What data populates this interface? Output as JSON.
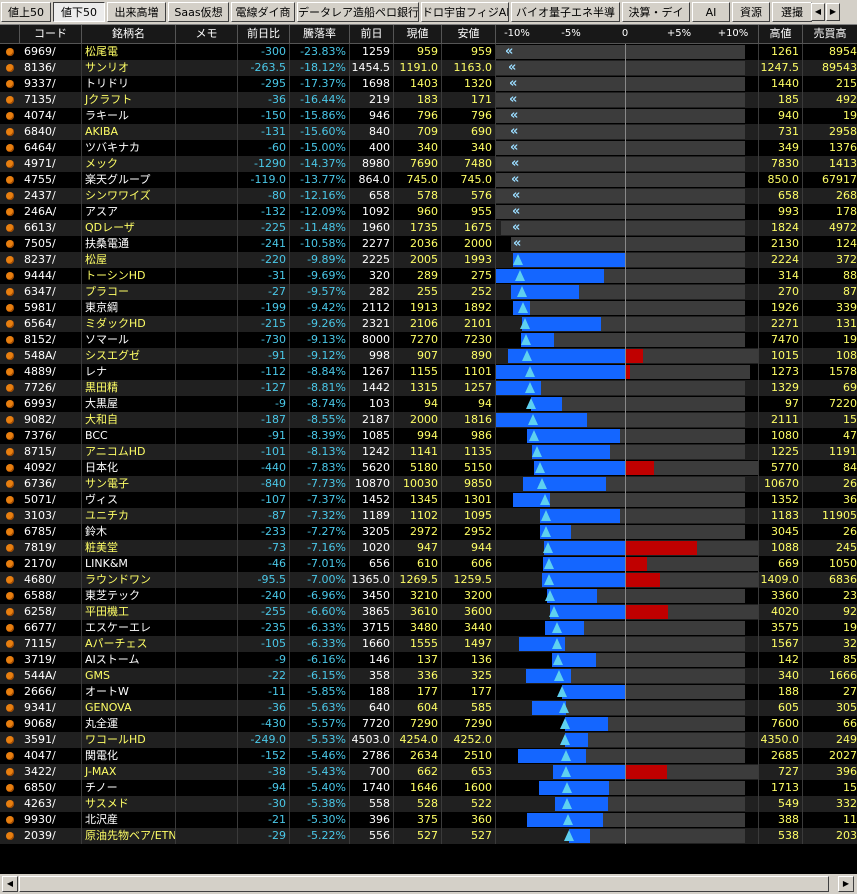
{
  "tabs": [
    {
      "label": "値上50",
      "active": false
    },
    {
      "label": "値下50",
      "active": true
    },
    {
      "label": "出来高増",
      "active": false
    },
    {
      "label": "Saas仮想",
      "active": false
    },
    {
      "label": "電線ダイ商",
      "active": false
    },
    {
      "label": "データレア造船ペロ銀行",
      "active": false
    },
    {
      "label": "ドロ宇宙フィジAI",
      "active": false
    },
    {
      "label": "バイオ量子エネ半導",
      "active": false
    },
    {
      "label": "決算・デイ",
      "active": false
    },
    {
      "label": "AI",
      "active": false
    },
    {
      "label": "資源",
      "active": false
    },
    {
      "label": "選撮",
      "active": false
    }
  ],
  "header": {
    "code": "コード",
    "name": "銘柄名",
    "memo": "メモ",
    "change": "前日比",
    "drop_pct": "騰落率",
    "prev": "前日",
    "current": "現値",
    "low": "安値",
    "high": "高値",
    "vol": "売買高"
  },
  "scale_labels": [
    "-10%",
    "-5%",
    "0",
    "+5%",
    "+10%"
  ],
  "colors": {
    "up_bar": "#c00000",
    "down_bar": "#1466ff",
    "marker": "#5ed0f0",
    "yellow": "#ffff66",
    "cyan": "#4ac8e8"
  },
  "rows": [
    {
      "code": "6969/",
      "name": "松尾電",
      "yel": true,
      "chg": "-300",
      "pct": "-23.83%",
      "prev": "1259",
      "cur": "959",
      "low": "959",
      "high": "1261",
      "vol": "8954",
      "bar": [
        -10,
        -10,
        -23.83,
        -23.83,
        0.2
      ]
    },
    {
      "code": "8136/",
      "name": "サンリオ",
      "yel": true,
      "chg": "-263.5",
      "pct": "-18.12%",
      "prev": "1454.5",
      "cur": "1191.0",
      "low": "1163.0",
      "high": "1247.5",
      "vol": "89543",
      "bar": [
        -10,
        -10,
        -18.12,
        -18.12,
        -14.2
      ]
    },
    {
      "code": "9337/",
      "name": "トリドリ",
      "yel": false,
      "chg": "-295",
      "pct": "-17.37%",
      "prev": "1698",
      "cur": "1403",
      "low": "1320",
      "high": "1440",
      "vol": "215",
      "bar": [
        -10,
        -10,
        -17.37,
        -17.37,
        -15.2
      ]
    },
    {
      "code": "7135/",
      "name": "Jクラフト",
      "yel": true,
      "chg": "-36",
      "pct": "-16.44%",
      "prev": "219",
      "cur": "183",
      "low": "171",
      "high": "185",
      "vol": "492",
      "bar": [
        -10,
        -10,
        -16.44,
        -16.44,
        -15.5
      ]
    },
    {
      "code": "4074/",
      "name": "ラキール",
      "yel": false,
      "chg": "-150",
      "pct": "-15.86%",
      "prev": "946",
      "cur": "796",
      "low": "796",
      "high": "940",
      "vol": "19",
      "bar": [
        -10,
        -10,
        -15.86,
        -15.86,
        -0.6
      ]
    },
    {
      "code": "6840/",
      "name": "AKIBA",
      "yel": true,
      "chg": "-131",
      "pct": "-15.60%",
      "prev": "840",
      "cur": "709",
      "low": "690",
      "high": "731",
      "vol": "2958",
      "bar": [
        -10,
        -10,
        -15.6,
        -15.6,
        -13.0
      ]
    },
    {
      "code": "6464/",
      "name": "ツバキナカ",
      "yel": false,
      "chg": "-60",
      "pct": "-15.00%",
      "prev": "400",
      "cur": "340",
      "low": "340",
      "high": "349",
      "vol": "1376",
      "bar": [
        -10,
        -10,
        -15.0,
        -15.0,
        -12.8
      ]
    },
    {
      "code": "4971/",
      "name": "メック",
      "yel": true,
      "chg": "-1290",
      "pct": "-14.37%",
      "prev": "8980",
      "cur": "7690",
      "low": "7480",
      "high": "7830",
      "vol": "1413",
      "bar": [
        -10,
        -10,
        -14.37,
        -14.37,
        -12.8
      ]
    },
    {
      "code": "4755/",
      "name": "楽天グループ",
      "yel": false,
      "chg": "-119.0",
      "pct": "-13.77%",
      "prev": "864.0",
      "cur": "745.0",
      "low": "745.0",
      "high": "850.0",
      "vol": "67917",
      "bar": [
        -10,
        -10,
        -13.77,
        -13.77,
        -1.6
      ]
    },
    {
      "code": "2437/",
      "name": "シンワワイズ",
      "yel": true,
      "chg": "-80",
      "pct": "-12.16%",
      "prev": "658",
      "cur": "578",
      "low": "576",
      "high": "658",
      "vol": "268",
      "bar": [
        -10,
        -10,
        -12.16,
        -12.16,
        0
      ]
    },
    {
      "code": "246A/",
      "name": "アスア",
      "yel": false,
      "chg": "-132",
      "pct": "-12.09%",
      "prev": "1092",
      "cur": "960",
      "low": "955",
      "high": "993",
      "vol": "178",
      "bar": [
        -10,
        -10,
        -12.09,
        -12.09,
        -9.1
      ]
    },
    {
      "code": "6613/",
      "name": "QDレーザ",
      "yel": true,
      "chg": "-225",
      "pct": "-11.48%",
      "prev": "1960",
      "cur": "1735",
      "low": "1675",
      "high": "1824",
      "vol": "4972",
      "bar": [
        -10,
        -10,
        -11.48,
        -11.48,
        -6.9
      ]
    },
    {
      "code": "7505/",
      "name": "扶桑電通",
      "yel": false,
      "chg": "-241",
      "pct": "-10.58%",
      "prev": "2277",
      "cur": "2036",
      "low": "2000",
      "high": "2130",
      "vol": "124",
      "bar": [
        -10,
        -10,
        -10.58,
        -10.58,
        -6.5
      ]
    },
    {
      "code": "8237/",
      "name": "松屋",
      "yel": true,
      "chg": "-220",
      "pct": "-9.89%",
      "prev": "2225",
      "cur": "2005",
      "low": "1993",
      "high": "2224",
      "vol": "372",
      "bar": [
        -10,
        -10.4,
        -9.89,
        0,
        0
      ]
    },
    {
      "code": "9444/",
      "name": "トーシンHD",
      "yel": true,
      "chg": "-31",
      "pct": "-9.69%",
      "prev": "320",
      "cur": "289",
      "low": "275",
      "high": "314",
      "vol": "88",
      "bar": [
        -10,
        -14.0,
        -9.69,
        -1.9,
        -1.9
      ]
    },
    {
      "code": "6347/",
      "name": "プラコー",
      "yel": true,
      "chg": "-27",
      "pct": "-9.57%",
      "prev": "282",
      "cur": "255",
      "low": "252",
      "high": "270",
      "vol": "87",
      "bar": [
        -10,
        -10.6,
        -9.57,
        -4.3,
        -4.3
      ]
    },
    {
      "code": "5981/",
      "name": "東京綱",
      "yel": false,
      "chg": "-199",
      "pct": "-9.42%",
      "prev": "2112",
      "cur": "1913",
      "low": "1892",
      "high": "1926",
      "vol": "339",
      "bar": [
        -10,
        -10.4,
        -9.42,
        -8.8,
        -8.8
      ]
    },
    {
      "code": "6564/",
      "name": "ミダックHD",
      "yel": true,
      "chg": "-215",
      "pct": "-9.26%",
      "prev": "2321",
      "cur": "2106",
      "low": "2101",
      "high": "2271",
      "vol": "131",
      "bar": [
        -10,
        -9.5,
        -9.26,
        -2.2,
        -2.2
      ]
    },
    {
      "code": "8152/",
      "name": "ソマール",
      "yel": false,
      "chg": "-730",
      "pct": "-9.13%",
      "prev": "8000",
      "cur": "7270",
      "low": "7230",
      "high": "7470",
      "vol": "19",
      "bar": [
        -10,
        -9.6,
        -9.13,
        -6.6,
        -6.6
      ]
    },
    {
      "code": "548A/",
      "name": "シスエグゼ",
      "yel": true,
      "chg": "-91",
      "pct": "-9.12%",
      "prev": "998",
      "cur": "907",
      "low": "890",
      "high": "1015",
      "vol": "108",
      "bar": [
        -10,
        -10.8,
        -9.12,
        1.7,
        1.7
      ]
    },
    {
      "code": "4889/",
      "name": "レナ",
      "yel": false,
      "chg": "-112",
      "pct": "-8.84%",
      "prev": "1267",
      "cur": "1155",
      "low": "1101",
      "high": "1273",
      "vol": "1578",
      "bar": [
        -10,
        -13.1,
        -8.84,
        0.5,
        0.5
      ]
    },
    {
      "code": "7726/",
      "name": "黒田精",
      "yel": true,
      "chg": "-127",
      "pct": "-8.81%",
      "prev": "1442",
      "cur": "1315",
      "low": "1257",
      "high": "1329",
      "vol": "69",
      "bar": [
        -10,
        -12.8,
        -8.81,
        -7.8,
        -7.8
      ]
    },
    {
      "code": "6993/",
      "name": "大黒屋",
      "yel": false,
      "chg": "-9",
      "pct": "-8.74%",
      "prev": "103",
      "cur": "94",
      "low": "94",
      "high": "97",
      "vol": "7220",
      "bar": [
        -10,
        -8.74,
        -8.74,
        -5.8,
        -5.8
      ]
    },
    {
      "code": "9082/",
      "name": "大和自",
      "yel": true,
      "chg": "-187",
      "pct": "-8.55%",
      "prev": "2187",
      "cur": "2000",
      "low": "1816",
      "high": "2111",
      "vol": "15",
      "bar": [
        -10,
        -17.0,
        -8.55,
        -3.5,
        -3.5
      ]
    },
    {
      "code": "7376/",
      "name": "BCC",
      "yel": false,
      "chg": "-91",
      "pct": "-8.39%",
      "prev": "1085",
      "cur": "994",
      "low": "986",
      "high": "1080",
      "vol": "47",
      "bar": [
        -10,
        -9.1,
        -8.39,
        -0.5,
        -0.5
      ]
    },
    {
      "code": "8715/",
      "name": "アニコムHD",
      "yel": true,
      "chg": "-101",
      "pct": "-8.13%",
      "prev": "1242",
      "cur": "1141",
      "low": "1135",
      "high": "1225",
      "vol": "1191",
      "bar": [
        -10,
        -8.6,
        -8.13,
        -1.4,
        -1.4
      ]
    },
    {
      "code": "4092/",
      "name": "日本化",
      "yel": false,
      "chg": "-440",
      "pct": "-7.83%",
      "prev": "5620",
      "cur": "5180",
      "low": "5150",
      "high": "5770",
      "vol": "84",
      "bar": [
        -10,
        -8.4,
        -7.83,
        2.7,
        2.7
      ]
    },
    {
      "code": "6736/",
      "name": "サン電子",
      "yel": true,
      "chg": "-840",
      "pct": "-7.73%",
      "prev": "10870",
      "cur": "10030",
      "low": "9850",
      "high": "10670",
      "vol": "26",
      "bar": [
        -10,
        -9.4,
        -7.73,
        -1.8,
        -1.8
      ]
    },
    {
      "code": "5071/",
      "name": "ヴィス",
      "yel": false,
      "chg": "-107",
      "pct": "-7.37%",
      "prev": "1452",
      "cur": "1345",
      "low": "1301",
      "high": "1352",
      "vol": "36",
      "bar": [
        -10,
        -10.4,
        -7.37,
        -6.9,
        -6.9
      ]
    },
    {
      "code": "3103/",
      "name": "ユニチカ",
      "yel": true,
      "chg": "-87",
      "pct": "-7.32%",
      "prev": "1189",
      "cur": "1102",
      "low": "1095",
      "high": "1183",
      "vol": "11905",
      "bar": [
        -10,
        -7.9,
        -7.32,
        -0.5,
        -0.5
      ]
    },
    {
      "code": "6785/",
      "name": "鈴木",
      "yel": false,
      "chg": "-233",
      "pct": "-7.27%",
      "prev": "3205",
      "cur": "2972",
      "low": "2952",
      "high": "3045",
      "vol": "26",
      "bar": [
        -10,
        -7.9,
        -7.27,
        -5.0,
        -5.0
      ]
    },
    {
      "code": "7819/",
      "name": "粧美堂",
      "yel": true,
      "chg": "-73",
      "pct": "-7.16%",
      "prev": "1020",
      "cur": "947",
      "low": "944",
      "high": "1088",
      "vol": "245",
      "bar": [
        -10,
        -7.5,
        -7.16,
        6.7,
        6.7
      ]
    },
    {
      "code": "2170/",
      "name": "LINK&M",
      "yel": false,
      "chg": "-46",
      "pct": "-7.01%",
      "prev": "656",
      "cur": "610",
      "low": "606",
      "high": "669",
      "vol": "1050",
      "bar": [
        -10,
        -7.6,
        -7.01,
        2.0,
        2.0
      ]
    },
    {
      "code": "4680/",
      "name": "ラウンドワン",
      "yel": true,
      "chg": "-95.5",
      "pct": "-7.00%",
      "prev": "1365.0",
      "cur": "1269.5",
      "low": "1259.5",
      "high": "1409.0",
      "vol": "6836",
      "bar": [
        -10,
        -7.7,
        -7.0,
        3.2,
        3.2
      ]
    },
    {
      "code": "6588/",
      "name": "東芝テック",
      "yel": false,
      "chg": "-240",
      "pct": "-6.96%",
      "prev": "3450",
      "cur": "3210",
      "low": "3200",
      "high": "3360",
      "vol": "23",
      "bar": [
        -10,
        -7.2,
        -6.96,
        -2.6,
        -2.6
      ]
    },
    {
      "code": "6258/",
      "name": "平田機工",
      "yel": true,
      "chg": "-255",
      "pct": "-6.60%",
      "prev": "3865",
      "cur": "3610",
      "low": "3600",
      "high": "4020",
      "vol": "92",
      "bar": [
        -10,
        -6.9,
        -6.6,
        4.0,
        4.0
      ]
    },
    {
      "code": "6677/",
      "name": "エスケーエレ",
      "yel": false,
      "chg": "-235",
      "pct": "-6.33%",
      "prev": "3715",
      "cur": "3480",
      "low": "3440",
      "high": "3575",
      "vol": "19",
      "bar": [
        -10,
        -7.4,
        -6.33,
        -3.8,
        -3.8
      ]
    },
    {
      "code": "7115/",
      "name": "Aパーチェス",
      "yel": true,
      "chg": "-105",
      "pct": "-6.33%",
      "prev": "1660",
      "cur": "1555",
      "low": "1497",
      "high": "1567",
      "vol": "32",
      "bar": [
        -10,
        -9.8,
        -6.33,
        -5.6,
        -5.6
      ]
    },
    {
      "code": "3719/",
      "name": "AIストーム",
      "yel": false,
      "chg": "-9",
      "pct": "-6.16%",
      "prev": "146",
      "cur": "137",
      "low": "136",
      "high": "142",
      "vol": "85",
      "bar": [
        -10,
        -6.8,
        -6.16,
        -2.7,
        -2.7
      ]
    },
    {
      "code": "544A/",
      "name": "GMS",
      "yel": true,
      "chg": "-22",
      "pct": "-6.15%",
      "prev": "358",
      "cur": "336",
      "low": "325",
      "high": "340",
      "vol": "1666",
      "bar": [
        -10,
        -9.2,
        -6.15,
        -5.0,
        -5.0
      ]
    },
    {
      "code": "2666/",
      "name": "オートW",
      "yel": false,
      "chg": "-11",
      "pct": "-5.85%",
      "prev": "188",
      "cur": "177",
      "low": "177",
      "high": "188",
      "vol": "27",
      "bar": [
        -10,
        -5.85,
        -5.85,
        0,
        0
      ]
    },
    {
      "code": "9341/",
      "name": "GENOVA",
      "yel": true,
      "chg": "-36",
      "pct": "-5.63%",
      "prev": "640",
      "cur": "604",
      "low": "585",
      "high": "605",
      "vol": "305",
      "bar": [
        -10,
        -8.6,
        -5.63,
        -5.5,
        -5.5
      ]
    },
    {
      "code": "9068/",
      "name": "丸全運",
      "yel": false,
      "chg": "-430",
      "pct": "-5.57%",
      "prev": "7720",
      "cur": "7290",
      "low": "7290",
      "high": "7600",
      "vol": "66",
      "bar": [
        -10,
        -5.57,
        -5.57,
        -1.6,
        -1.6
      ]
    },
    {
      "code": "3591/",
      "name": "ワコールHD",
      "yel": true,
      "chg": "-249.0",
      "pct": "-5.53%",
      "prev": "4503.0",
      "cur": "4254.0",
      "low": "4252.0",
      "high": "4350.0",
      "vol": "249",
      "bar": [
        -10,
        -5.6,
        -5.53,
        -3.4,
        -3.4
      ]
    },
    {
      "code": "4047/",
      "name": "関電化",
      "yel": false,
      "chg": "-152",
      "pct": "-5.46%",
      "prev": "2786",
      "cur": "2634",
      "low": "2510",
      "high": "2685",
      "vol": "2027",
      "bar": [
        -10,
        -9.9,
        -5.46,
        -3.6,
        -3.6
      ]
    },
    {
      "code": "3422/",
      "name": "J-MAX",
      "yel": true,
      "chg": "-38",
      "pct": "-5.43%",
      "prev": "700",
      "cur": "662",
      "low": "653",
      "high": "727",
      "vol": "396",
      "bar": [
        -10,
        -6.7,
        -5.43,
        3.9,
        3.9
      ]
    },
    {
      "code": "6850/",
      "name": "チノー",
      "yel": false,
      "chg": "-94",
      "pct": "-5.40%",
      "prev": "1740",
      "cur": "1646",
      "low": "1600",
      "high": "1713",
      "vol": "15",
      "bar": [
        -10,
        -8.0,
        -5.4,
        -1.5,
        -1.5
      ]
    },
    {
      "code": "4263/",
      "name": "サスメド",
      "yel": true,
      "chg": "-30",
      "pct": "-5.38%",
      "prev": "558",
      "cur": "528",
      "low": "522",
      "high": "549",
      "vol": "332",
      "bar": [
        -10,
        -6.5,
        -5.38,
        -1.6,
        -1.6
      ]
    },
    {
      "code": "9930/",
      "name": "北沢産",
      "yel": false,
      "chg": "-21",
      "pct": "-5.30%",
      "prev": "396",
      "cur": "375",
      "low": "360",
      "high": "388",
      "vol": "11",
      "bar": [
        -10,
        -9.1,
        -5.3,
        -2.0,
        -2.0
      ]
    },
    {
      "code": "2039/",
      "name": "原油先物ベア/ETN",
      "yel": true,
      "chg": "-29",
      "pct": "-5.22%",
      "prev": "556",
      "cur": "527",
      "low": "527",
      "high": "538",
      "vol": "203",
      "bar": [
        -10,
        -5.22,
        -5.22,
        -3.2,
        -3.2
      ]
    }
  ]
}
